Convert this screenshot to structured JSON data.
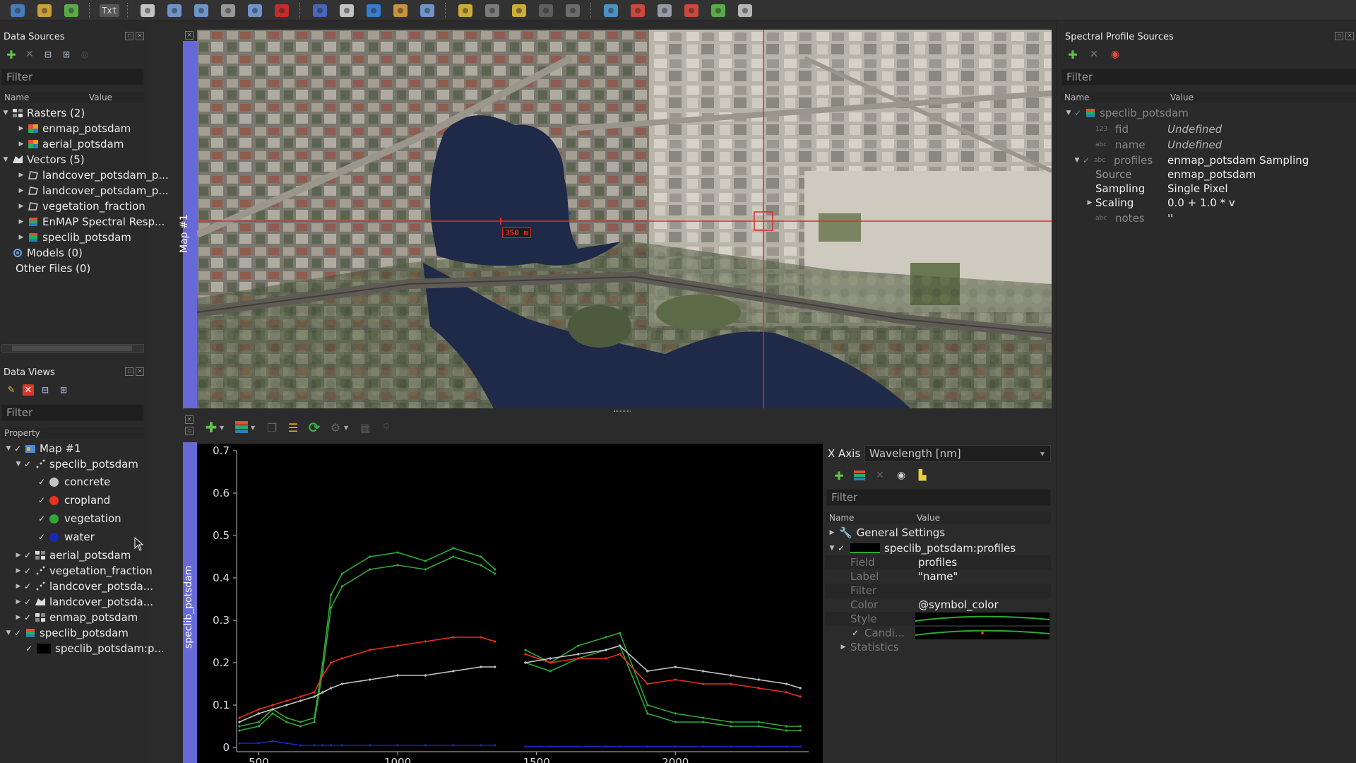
{
  "colors": {
    "accent_strip": "#6769d6",
    "crosshair": "#e02a2a",
    "plot_bg": "#000000",
    "class_concrete": "#c4c4c4",
    "class_cropland": "#e8301e",
    "class_vegetation": "#2fa837",
    "class_water": "#1b27b5"
  },
  "toolbar": {
    "icons": [
      "open-project-icon",
      "add-raster-icon",
      "add-vector-icon",
      "text-icon",
      "pan-icon",
      "zoom-in-icon",
      "zoom-out-icon",
      "zoom-native-icon",
      "zoom-full-icon",
      "select-cursor-icon",
      "identify-icon",
      "spectral-profile-icon",
      "move-center-icon",
      "pin-icon",
      "settings-icon",
      "select-feature-icon",
      "layers-icon",
      "pencil-icon",
      "save-edits-icon",
      "dots-icon",
      "globe-icon",
      "stack-icon",
      "gear-tool-icon",
      "curve-icon",
      "location-icon",
      "satellite-icon"
    ],
    "text_button": "Txt"
  },
  "data_sources": {
    "title": "Data Sources",
    "filter_placeholder": "Filter",
    "col_name": "Name",
    "col_value": "Value",
    "items": [
      {
        "label": "Rasters (2)"
      },
      {
        "label": "enmap_potsdam"
      },
      {
        "label": "aerial_potsdam"
      },
      {
        "label": "Vectors (5)"
      },
      {
        "label": "landcover_potsdam_p..."
      },
      {
        "label": "landcover_potsdam_p..."
      },
      {
        "label": "vegetation_fraction"
      },
      {
        "label": "EnMAP Spectral Resp..."
      },
      {
        "label": "speclib_potsdam"
      },
      {
        "label": "Models (0)"
      },
      {
        "label": "Other Files (0)"
      }
    ]
  },
  "data_views": {
    "title": "Data Views",
    "filter_placeholder": "Filter",
    "col_property": "Property",
    "items": [
      {
        "label": "Map #1"
      },
      {
        "label": "speclib_potsdam"
      },
      {
        "label": "concrete"
      },
      {
        "label": "cropland"
      },
      {
        "label": "vegetation"
      },
      {
        "label": "water"
      },
      {
        "label": "aerial_potsdam"
      },
      {
        "label": "vegetation_fraction"
      },
      {
        "label": "landcover_potsda..."
      },
      {
        "label": "landcover_potsda..."
      },
      {
        "label": "enmap_potsdam"
      },
      {
        "label": "speclib_potsdam"
      },
      {
        "label": "speclib_potsdam:p..."
      }
    ]
  },
  "map": {
    "label": "Map #1",
    "scale_label": "350 m"
  },
  "spectral_view": {
    "label": "speclib_potsdam"
  },
  "chart_data": {
    "type": "line",
    "title": "",
    "xlabel": "",
    "ylabel": "",
    "yticks": [
      "0",
      "0.1",
      "0.2",
      "0.3",
      "0.4",
      "0.5",
      "0.6",
      "0.7"
    ],
    "xticks": [
      "500",
      "1000",
      "1500",
      "2000"
    ],
    "ylim": [
      0,
      0.7
    ],
    "xlim": [
      420,
      2480
    ],
    "gap": [
      1350,
      1460
    ],
    "series": [
      {
        "color": "#2fa837",
        "x": [
          430,
          500,
          550,
          600,
          650,
          700,
          730,
          760,
          800,
          900,
          1000,
          1100,
          1200,
          1300,
          1350,
          1460,
          1550,
          1650,
          1750,
          1800,
          1900,
          2000,
          2100,
          2200,
          2300,
          2400,
          2450
        ],
        "y": [
          0.04,
          0.05,
          0.08,
          0.06,
          0.05,
          0.06,
          0.18,
          0.33,
          0.38,
          0.42,
          0.43,
          0.42,
          0.45,
          0.43,
          0.41,
          0.2,
          0.18,
          0.21,
          0.23,
          0.24,
          0.08,
          0.06,
          0.06,
          0.05,
          0.05,
          0.04,
          0.04
        ]
      },
      {
        "color": "#2fa837",
        "x": [
          430,
          500,
          550,
          600,
          650,
          700,
          730,
          760,
          800,
          900,
          1000,
          1100,
          1200,
          1300,
          1350,
          1460,
          1550,
          1650,
          1750,
          1800,
          1900,
          2000,
          2100,
          2200,
          2300,
          2400,
          2450
        ],
        "y": [
          0.05,
          0.06,
          0.09,
          0.07,
          0.06,
          0.07,
          0.2,
          0.36,
          0.41,
          0.45,
          0.46,
          0.44,
          0.47,
          0.45,
          0.42,
          0.23,
          0.2,
          0.24,
          0.26,
          0.27,
          0.1,
          0.08,
          0.07,
          0.06,
          0.06,
          0.05,
          0.05
        ]
      },
      {
        "color": "#e8301e",
        "x": [
          430,
          500,
          550,
          600,
          650,
          700,
          730,
          760,
          800,
          900,
          1000,
          1100,
          1200,
          1300,
          1350,
          1460,
          1550,
          1650,
          1750,
          1800,
          1900,
          2000,
          2100,
          2200,
          2300,
          2400,
          2450
        ],
        "y": [
          0.07,
          0.09,
          0.1,
          0.11,
          0.12,
          0.13,
          0.17,
          0.2,
          0.21,
          0.23,
          0.24,
          0.25,
          0.26,
          0.26,
          0.25,
          0.22,
          0.2,
          0.21,
          0.21,
          0.22,
          0.15,
          0.16,
          0.15,
          0.15,
          0.14,
          0.13,
          0.12
        ]
      },
      {
        "color": "#c4c4c4",
        "x": [
          430,
          500,
          550,
          600,
          650,
          700,
          730,
          760,
          800,
          900,
          1000,
          1100,
          1200,
          1300,
          1350,
          1460,
          1550,
          1650,
          1750,
          1800,
          1900,
          2000,
          2100,
          2200,
          2300,
          2400,
          2450
        ],
        "y": [
          0.06,
          0.08,
          0.09,
          0.1,
          0.11,
          0.12,
          0.13,
          0.14,
          0.15,
          0.16,
          0.17,
          0.17,
          0.18,
          0.19,
          0.19,
          0.2,
          0.21,
          0.22,
          0.23,
          0.24,
          0.18,
          0.19,
          0.18,
          0.17,
          0.16,
          0.15,
          0.14
        ]
      },
      {
        "color": "#1b27b5",
        "x": [
          430,
          500,
          550,
          600,
          650,
          700,
          730,
          760,
          800,
          900,
          1000,
          1100,
          1200,
          1300,
          1350,
          1460,
          1550,
          1650,
          1750,
          1800,
          1900,
          2000,
          2100,
          2200,
          2300,
          2400,
          2450
        ],
        "y": [
          0.01,
          0.01,
          0.015,
          0.01,
          0.005,
          0.005,
          0.005,
          0.005,
          0.005,
          0.005,
          0.005,
          0.005,
          0.005,
          0.005,
          0.005,
          0.002,
          0.002,
          0.002,
          0.002,
          0.002,
          0.002,
          0.002,
          0.002,
          0.002,
          0.002,
          0.002,
          0.002
        ]
      }
    ]
  },
  "plot_settings": {
    "x_axis_label": "X Axis",
    "x_axis_value": "Wavelength [nm]",
    "filter_placeholder": "Filter",
    "col_name": "Name",
    "col_value": "Value",
    "general_settings": "General Settings",
    "profile_visualization": "speclib_potsdam:profiles",
    "field_key": "Field",
    "field_val": "profiles",
    "label_key": "Label",
    "label_val": "\"name\"",
    "filter_key": "Filter",
    "color_key": "Color",
    "color_val": "@symbol_color",
    "style_key": "Style",
    "candidate_key": "Candi...",
    "statistics_key": "Statistics"
  },
  "spectral_sources": {
    "title": "Spectral Profile Sources",
    "filter_placeholder": "Filter",
    "col_name": "Name",
    "col_value": "Value",
    "root": "speclib_potsdam",
    "fid_key": "fid",
    "fid_type": "123",
    "fid_val": "Undefined",
    "name_key": "name",
    "name_type": "abc",
    "name_val": "Undefined",
    "profiles_key": "profiles",
    "profiles_type": "abc",
    "profiles_val": "enmap_potsdam Sampling",
    "source_key": "Source",
    "source_val": "enmap_potsdam",
    "sampling_key": "Sampling",
    "sampling_val": "Single Pixel",
    "scaling_key": "Scaling",
    "scaling_val": "0.0 + 1.0 * v",
    "notes_key": "notes",
    "notes_type": "abc",
    "notes_val": "''"
  }
}
